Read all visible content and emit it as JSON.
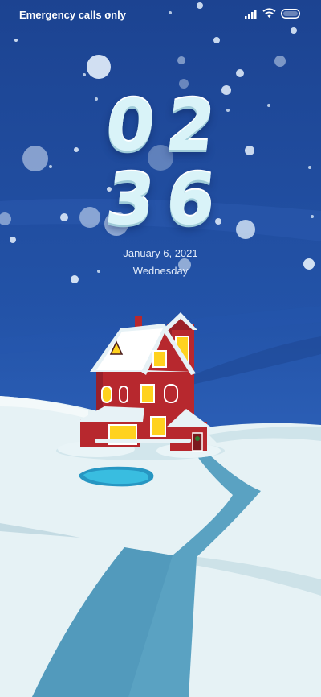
{
  "status_bar": {
    "carrier_text": "Emergency calls only",
    "icons": [
      "signal-icon",
      "wifi-icon",
      "battery-icon"
    ]
  },
  "lock_screen": {
    "clock_hours": "02",
    "clock_minutes": "36",
    "date": "January 6, 2021",
    "weekday": "Wednesday"
  },
  "wallpaper": {
    "theme": "winter-night-house",
    "colors": {
      "sky": "#1c4391",
      "snow": "#e4f1f4",
      "path": "#5aa2c2",
      "house": "#b7282e",
      "window": "#ffd21f",
      "pond": "#34b4d9"
    }
  }
}
